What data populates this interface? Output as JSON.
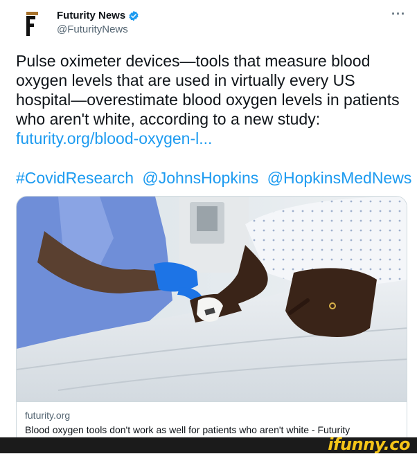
{
  "author": {
    "display_name": "Futurity News",
    "handle": "@FuturityNews",
    "verified": true,
    "avatar_letter": "F"
  },
  "more_menu": "···",
  "tweet": {
    "text": "Pulse oximeter devices—tools that measure blood oxygen levels that are used in virtually every US hospital—overestimate blood oxygen levels in patients who aren't white, according to a new study:",
    "link": "futurity.org/blood-oxygen-l...",
    "hashtags": [
      "#CovidResearch",
      "@JohnsHopkins",
      "@HopkinsMedNews"
    ]
  },
  "card": {
    "domain": "futurity.org",
    "title": "Blood oxygen tools don't work as well for patients who aren't white - Futurity"
  },
  "watermark": "ifunny.co",
  "colors": {
    "link": "#1d9bf0",
    "verified": "#1d9bf0",
    "watermark": "#f5c518"
  }
}
